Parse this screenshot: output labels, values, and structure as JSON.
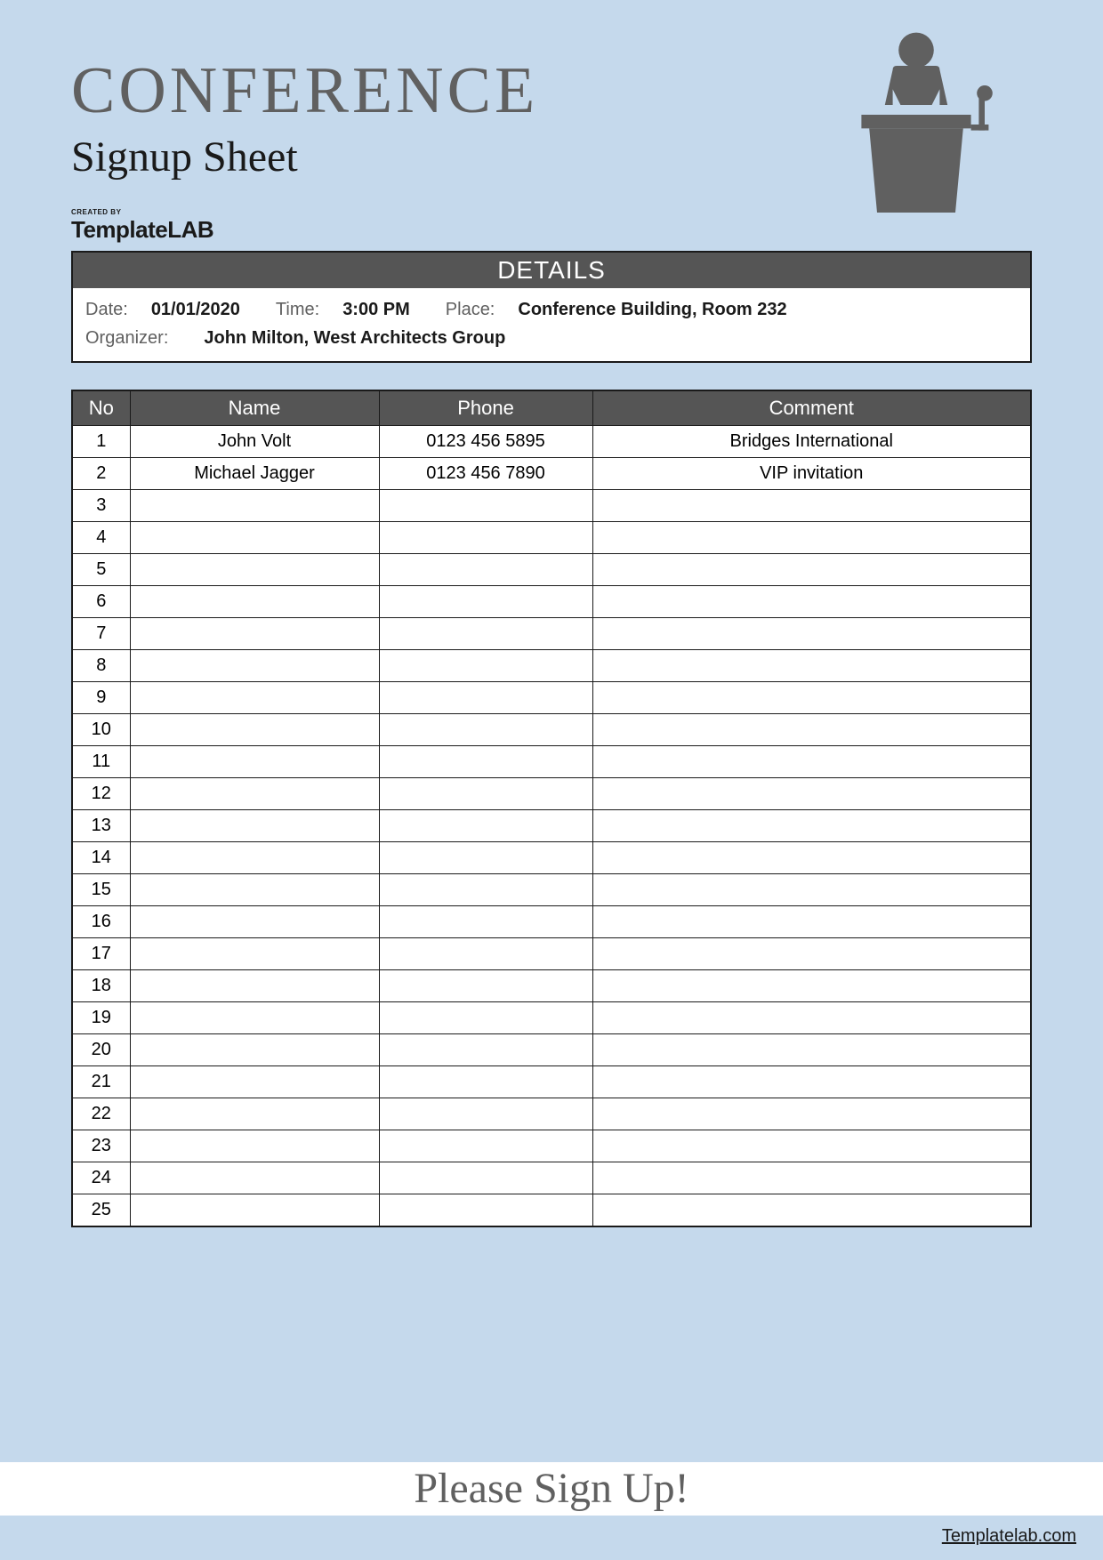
{
  "header": {
    "title": "CONFERENCE",
    "subtitle": "Signup Sheet"
  },
  "logo": {
    "created": "CREATED BY",
    "text": "TemplateLAB"
  },
  "details": {
    "heading": "DETAILS",
    "date_label": "Date:",
    "date_value": "01/01/2020",
    "time_label": "Time:",
    "time_value": "3:00 PM",
    "place_label": "Place:",
    "place_value": "Conference Building, Room 232",
    "organizer_label": "Organizer:",
    "organizer_value": "John Milton, West Architects Group"
  },
  "table": {
    "headers": {
      "no": "No",
      "name": "Name",
      "phone": "Phone",
      "comment": "Comment"
    },
    "rows": [
      {
        "no": "1",
        "name": "John Volt",
        "phone": "0123 456 5895",
        "comment": "Bridges International"
      },
      {
        "no": "2",
        "name": "Michael Jagger",
        "phone": "0123 456 7890",
        "comment": "VIP invitation"
      },
      {
        "no": "3",
        "name": "",
        "phone": "",
        "comment": ""
      },
      {
        "no": "4",
        "name": "",
        "phone": "",
        "comment": ""
      },
      {
        "no": "5",
        "name": "",
        "phone": "",
        "comment": ""
      },
      {
        "no": "6",
        "name": "",
        "phone": "",
        "comment": ""
      },
      {
        "no": "7",
        "name": "",
        "phone": "",
        "comment": ""
      },
      {
        "no": "8",
        "name": "",
        "phone": "",
        "comment": ""
      },
      {
        "no": "9",
        "name": "",
        "phone": "",
        "comment": ""
      },
      {
        "no": "10",
        "name": "",
        "phone": "",
        "comment": ""
      },
      {
        "no": "11",
        "name": "",
        "phone": "",
        "comment": ""
      },
      {
        "no": "12",
        "name": "",
        "phone": "",
        "comment": ""
      },
      {
        "no": "13",
        "name": "",
        "phone": "",
        "comment": ""
      },
      {
        "no": "14",
        "name": "",
        "phone": "",
        "comment": ""
      },
      {
        "no": "15",
        "name": "",
        "phone": "",
        "comment": ""
      },
      {
        "no": "16",
        "name": "",
        "phone": "",
        "comment": ""
      },
      {
        "no": "17",
        "name": "",
        "phone": "",
        "comment": ""
      },
      {
        "no": "18",
        "name": "",
        "phone": "",
        "comment": ""
      },
      {
        "no": "19",
        "name": "",
        "phone": "",
        "comment": ""
      },
      {
        "no": "20",
        "name": "",
        "phone": "",
        "comment": ""
      },
      {
        "no": "21",
        "name": "",
        "phone": "",
        "comment": ""
      },
      {
        "no": "22",
        "name": "",
        "phone": "",
        "comment": ""
      },
      {
        "no": "23",
        "name": "",
        "phone": "",
        "comment": ""
      },
      {
        "no": "24",
        "name": "",
        "phone": "",
        "comment": ""
      },
      {
        "no": "25",
        "name": "",
        "phone": "",
        "comment": ""
      }
    ]
  },
  "footer": {
    "banner": "Please Sign Up!",
    "link": "Templatelab.com"
  }
}
